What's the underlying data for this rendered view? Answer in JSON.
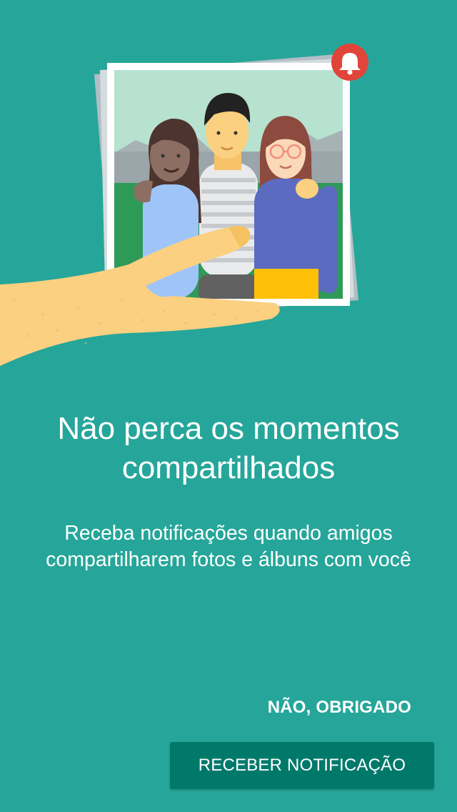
{
  "illustration": {
    "subject": "hand holding a photo of three friends",
    "badge_icon": "bell-icon",
    "colors": {
      "background": "#26a69a",
      "badge": "#e0443a",
      "photo_border": "#ffffff",
      "skin": "#fbd080"
    }
  },
  "headline": "Não perca os momentos compartilhados",
  "body": "Receba notificações quando amigos compartilharem fotos e álbuns com você",
  "actions": {
    "dismiss_label": "NÃO, OBRIGADO",
    "accept_label": "RECEBER NOTIFICAÇÃO"
  }
}
